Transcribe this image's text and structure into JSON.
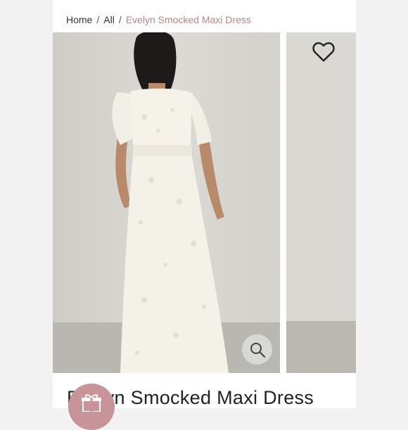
{
  "breadcrumb": {
    "home": "Home",
    "separator": "/",
    "all": "All",
    "current": "Evelyn Smocked Maxi Dress"
  },
  "product": {
    "title": "Evelyn Smocked Maxi Dress",
    "main_image": "model-back-view-white-maxi-dress",
    "secondary_image": "dress-gallery-next-image"
  },
  "icons": {
    "wishlist": "heart-icon",
    "zoom": "magnifier-icon",
    "gift": "gift-icon"
  },
  "colors": {
    "accent": "#b5868c",
    "gift_button": "#c9939a",
    "background": "#f2f2f2"
  }
}
